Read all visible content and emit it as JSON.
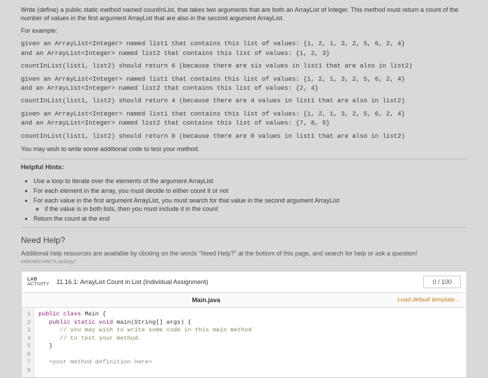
{
  "intro": {
    "p1": "Write (define) a public static method named countInList, that takes two arguments that are both an ArrayList of Integer. This method must return a count of the number of values in the first argument ArrayList that are also in the second argument ArrayList.",
    "forExample": "For example:",
    "ex1a": "given an ArrayList<Integer> named list1 that contains this list of values: {1, 2, 1, 3, 2, 5, 6, 2, 4}",
    "ex1b": "and an ArrayList<Integer> named list2 that contains this list of values: {1, 2, 3}",
    "ex1c": "countInList(list1, list2) should return 6 (because there are six values in list1 that are also in list2)",
    "ex2a": "given an ArrayList<Integer> named list1 that contains this list of values: {1, 2, 1, 3, 2, 5, 6, 2, 4}",
    "ex2b": "and an ArrayList<Integer> named list2 that contains this list of values: {2, 4}",
    "ex2c": "countInList(list1, list2) should return 4 (because there are 4 values in list1 that are also in list2)",
    "ex3a": "given an ArrayList<Integer> named list1 that contains this list of values: {1, 2, 1, 3, 2, 5, 6, 2, 4}",
    "ex3b": "and an ArrayList<Integer> named list2 that contains this list of values: {7, 8, 9}",
    "ex3c": "countInList(list1, list2) should return 0 (because there are 0 values in list1 that are also in list2)",
    "youMay": "You may wish to write some additional code to test your method."
  },
  "hints": {
    "title": "Helpful Hints:",
    "h1": "Use a loop to iterate over the elements of the argument ArrayList",
    "h2": "For each element in the array, you must decide to either count it or not",
    "h3": "For each value in the first argument ArrayList, you must search for that value in the second argument ArrayList",
    "h3a": "if the value is in both lists, then you must include it in the count",
    "h4": "Return the count at the end"
  },
  "needHelp": {
    "title": "Need Help?",
    "text": "Additional help resources are available by clicking on the words \"Need Help?\" at the bottom of this page, and search for help or ask a question!",
    "tiny": "445048314487A.qx3zqy7"
  },
  "activity": {
    "labLine1": "LAB",
    "labLine2": "ACTIVITY",
    "title": "11.16.1: ArrayList Count in List (Individual Assignment)",
    "score": "0 / 100",
    "tab": "Main.java",
    "loadDefault": "Load default template...",
    "gutter": [
      "1",
      "2",
      "3",
      "4",
      "5",
      "6",
      "7",
      "8"
    ],
    "code": {
      "l1a": "public class ",
      "l1b": "Main {",
      "l2a": "   public static void ",
      "l2b": "main(String[] args) {",
      "l3": "      // you may wish to write some code in this main method",
      "l4": "      // to test your method.",
      "l5": "   }",
      "l6": "",
      "l7": "   <your method definition here>",
      "l8": ""
    }
  }
}
